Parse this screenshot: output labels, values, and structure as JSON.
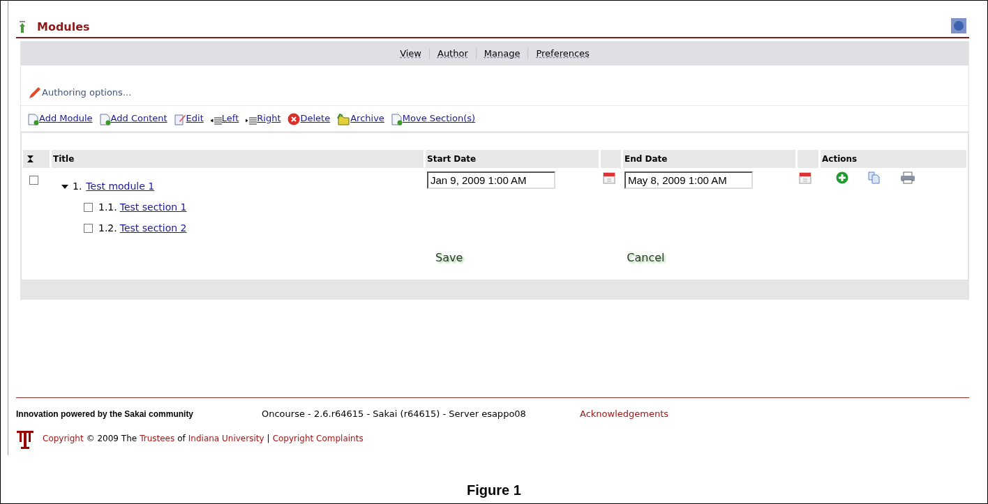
{
  "page": {
    "title": "Modules"
  },
  "nav": [
    "View",
    "Author",
    "Manage",
    "Preferences"
  ],
  "authoring": "Authoring options...",
  "toolbar": [
    "Add Module",
    "Add Content",
    "Edit",
    "Left",
    "Right",
    "Delete",
    "Archive",
    "Move Section(s)"
  ],
  "table": {
    "columns": [
      "Title",
      "Start Date",
      "End Date",
      "Actions"
    ],
    "rows": [
      {
        "checked": false,
        "number": "1.",
        "title": "Test module 1",
        "expanded": true,
        "start_date": "Jan 9, 2009 1:00 AM",
        "end_date": "May 8, 2009 1:00 AM",
        "children": [
          {
            "checked": false,
            "number": "1.1.",
            "title": "Test section 1"
          },
          {
            "checked": false,
            "number": "1.2.",
            "title": "Test section 2"
          }
        ]
      }
    ]
  },
  "buttons": [
    "Save",
    "Cancel"
  ],
  "footer": {
    "powered": "Innovation powered by the Sakai community",
    "server": "Oncourse - 2.6.r64615 - Sakai (r64615) - Server esappo08",
    "acknowledgements": "Acknowledgements",
    "copyright": [
      {
        "kind": "link",
        "text": "Copyright"
      },
      {
        "kind": "text",
        "text": "© 2009 The"
      },
      {
        "kind": "link",
        "text": "Trustees"
      },
      {
        "kind": "text",
        "text": "of"
      },
      {
        "kind": "link",
        "text": "Indiana University"
      },
      {
        "kind": "text",
        "text": "|"
      },
      {
        "kind": "link",
        "text": "Copyright Complaints"
      }
    ]
  },
  "caption": "Figure 1"
}
